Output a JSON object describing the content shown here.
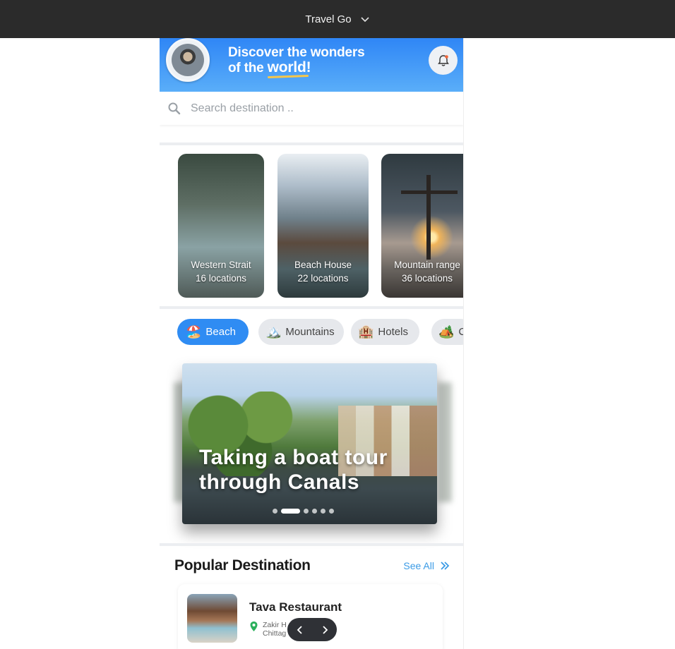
{
  "topbar": {
    "title": "Travel Go",
    "menu_icon": "chevron-down-icon"
  },
  "header": {
    "title_line1": "Discover the wonders",
    "title_line2_prefix": "of the ",
    "title_line2_highlight": "world!",
    "bell_icon": "bell-icon"
  },
  "search": {
    "placeholder": "Search destination ..",
    "value": ""
  },
  "cards": [
    {
      "name": "Western Strait",
      "count": "16 locations"
    },
    {
      "name": "Beach House",
      "count": "22 locations"
    },
    {
      "name": "Mountain range",
      "count": "36 locations"
    }
  ],
  "chips": [
    {
      "label": "Beach",
      "emoji": "🏖️",
      "active": true
    },
    {
      "label": "Mountains",
      "emoji": "🏔️",
      "active": false
    },
    {
      "label": "Hotels",
      "emoji": "🏨",
      "active": false
    },
    {
      "label": "Ca",
      "emoji": "🏕️",
      "active": false
    }
  ],
  "hero": {
    "title_line1": "Taking a boat tour",
    "title_line2": "through Canals",
    "slide_count": 6,
    "active_slide": 1
  },
  "popular": {
    "title": "Popular Destination",
    "see_all": "See All",
    "item": {
      "name": "Tava Restaurant",
      "loc_line1": "Zakir H",
      "loc_line2": "Chittag"
    }
  },
  "colors": {
    "accent": "#2f8cf3",
    "topbar": "#2b2b2b",
    "link": "#3b9be6"
  }
}
